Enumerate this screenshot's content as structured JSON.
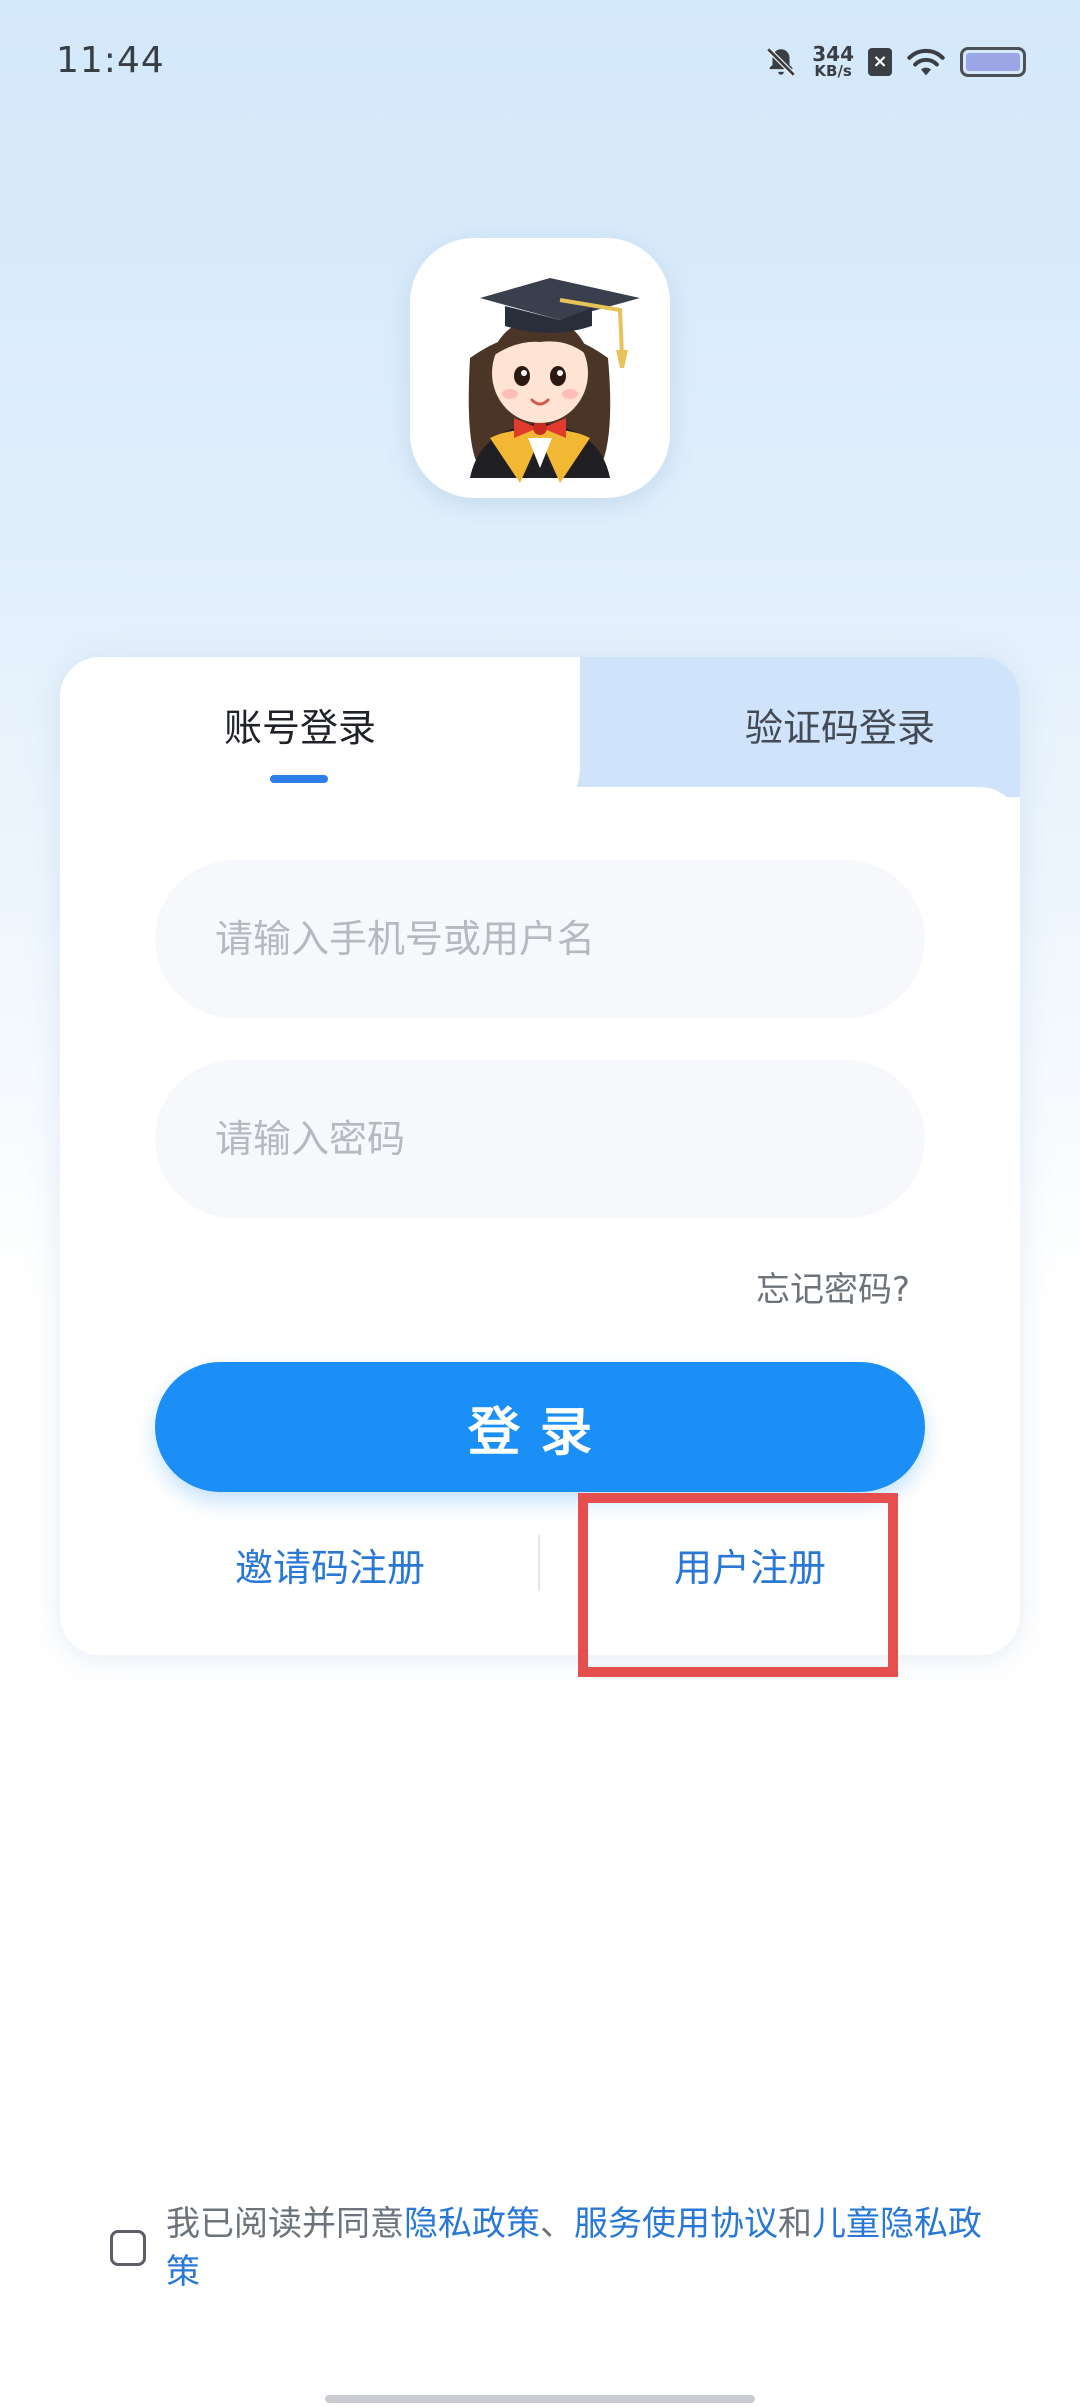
{
  "status_bar": {
    "time": "11:44",
    "net_speed_value": "344",
    "net_speed_unit": "KB/s",
    "icons": [
      "bell-off-icon",
      "sim-x-icon",
      "wifi-icon",
      "battery-icon"
    ]
  },
  "logo": {
    "icon": "graduate-girl-avatar"
  },
  "tabs": {
    "account_login": "账号登录",
    "code_login": "验证码登录"
  },
  "form": {
    "username_placeholder": "请输入手机号或用户名",
    "password_placeholder": "请输入密码",
    "forgot_password": "忘记密码?",
    "login_button": "登录"
  },
  "register": {
    "invite_code": "邀请码注册",
    "user_register": "用户注册"
  },
  "agreement": {
    "prefix": "我已阅读并同意",
    "privacy_policy": "隐私政策",
    "sep1": "、",
    "service_agreement": "服务使用协议",
    "and": "和",
    "children_privacy": "儿童隐私政策"
  },
  "colors": {
    "primary": "#1b8ff5",
    "link": "#2a78d6",
    "highlight": "#e5504f"
  }
}
